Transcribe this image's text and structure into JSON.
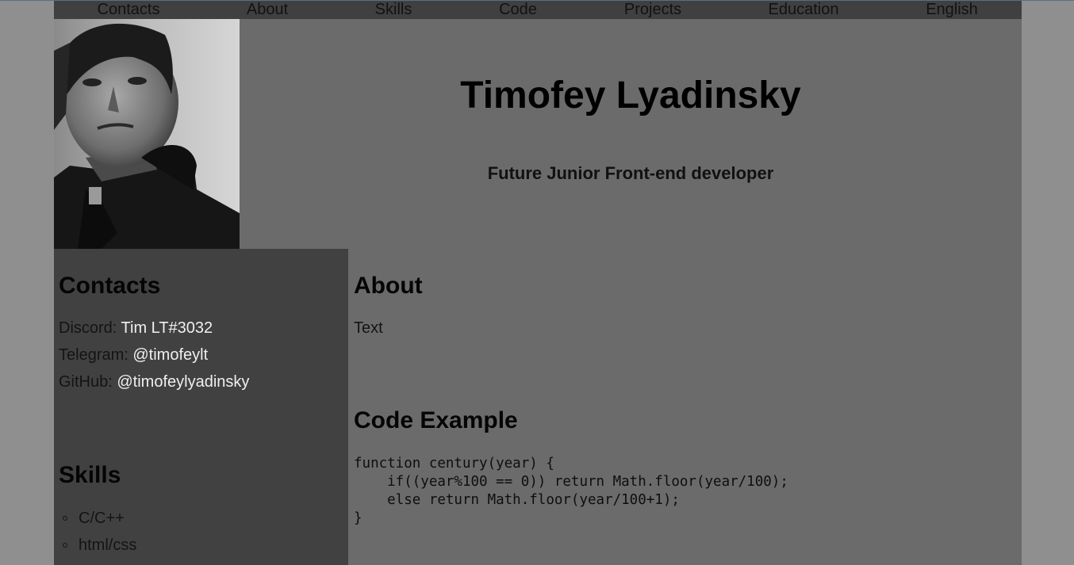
{
  "nav": {
    "items": [
      {
        "label": "Contacts"
      },
      {
        "label": "About"
      },
      {
        "label": "Skills"
      },
      {
        "label": "Code"
      },
      {
        "label": "Projects"
      },
      {
        "label": "Education"
      },
      {
        "label": "English"
      }
    ]
  },
  "header": {
    "name": "Timofey Lyadinsky",
    "subtitle": "Future Junior Front-end developer"
  },
  "contacts": {
    "title": "Contacts",
    "items": [
      {
        "label": "Discord: ",
        "value": "Tim LT#3032"
      },
      {
        "label": "Telegram: ",
        "value": "@timofeylt"
      },
      {
        "label": "GitHub: ",
        "value": "@timofeylyadinsky"
      }
    ]
  },
  "skills": {
    "title": "Skills",
    "items": [
      "C/C++",
      "html/css"
    ]
  },
  "about": {
    "title": "About",
    "text": "Text"
  },
  "code_example": {
    "title": "Code Example",
    "code": "function century(year) {\n    if((year%100 == 0)) return Math.floor(year/100);\n    else return Math.floor(year/100+1);\n}"
  },
  "colors": {
    "page_bg": "#8f8f8f",
    "content_bg": "#6b6b6b",
    "nav_bg": "#404040",
    "sidebar_bg": "#414141",
    "link": "#efefef"
  }
}
